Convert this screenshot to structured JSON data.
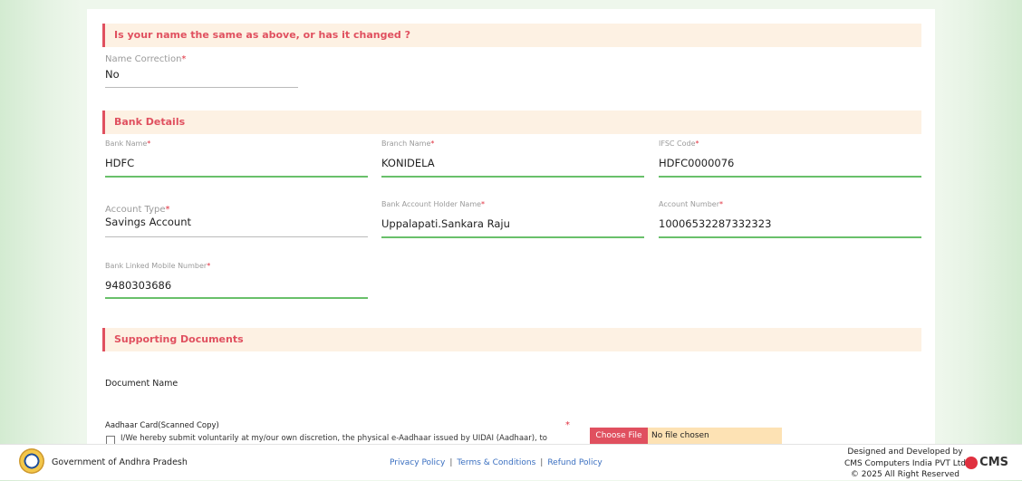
{
  "sections": {
    "name_change": "Is your name the same as above, or has it changed ?",
    "bank": "Bank Details",
    "docs": "Supporting Documents"
  },
  "fields": {
    "name_correction": {
      "label": "Name Correction",
      "value": "No"
    },
    "bank_name": {
      "label": "Bank Name",
      "value": "HDFC"
    },
    "branch_name": {
      "label": "Branch Name",
      "value": "KONIDELA"
    },
    "ifsc": {
      "label": "IFSC Code",
      "value": "HDFC0000076"
    },
    "account_type": {
      "label": "Account Type",
      "value": "Savings Account"
    },
    "holder_name": {
      "label": "Bank Account Holder Name",
      "value": "Uppalapati.Sankara Raju"
    },
    "account_number": {
      "label": "Account Number",
      "value": "10006532287332323"
    },
    "mobile": {
      "label": "Bank Linked Mobile Number",
      "value": "9480303686"
    }
  },
  "required_mark": "*",
  "documents": {
    "header": "Document Name",
    "aadhaar_label": "Aadhaar Card(Scanned Copy)",
    "consent_text": "I/We hereby submit voluntarily at my/our own discretion, the physical e-Aadhaar issued by UIDAI (Aadhaar), to",
    "choose_file": "Choose File",
    "no_file": "No file chosen"
  },
  "footer": {
    "org": "Government of Andhra Pradesh",
    "links": [
      "Privacy Policy",
      "Terms & Conditions",
      "Refund Policy"
    ],
    "credit_line1": "Designed and Developed by",
    "credit_line2": "CMS Computers India PVT Ltd",
    "credit_line3": "© 2025 All Right Reserved",
    "brand": "CMS"
  }
}
